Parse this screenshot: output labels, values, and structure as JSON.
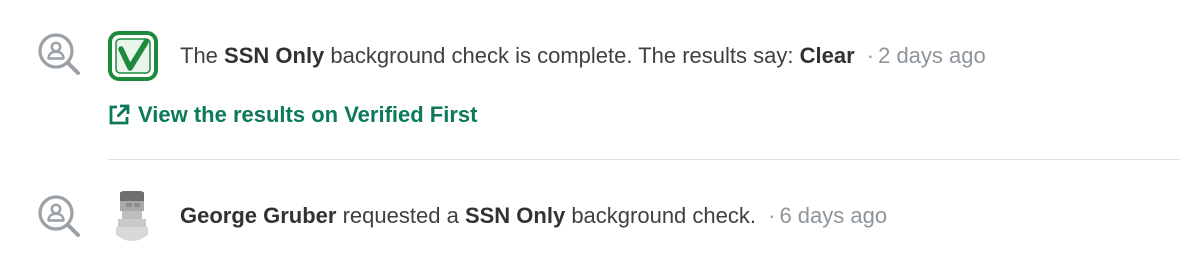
{
  "events": [
    {
      "icon": "person-search-icon",
      "logo": "verified-first-logo",
      "prefix": "The",
      "check_name": "SSN Only",
      "middle": "background check is complete. The results say:",
      "result": "Clear",
      "separator": "·",
      "time": "2 days ago",
      "link": {
        "icon": "external-link-icon",
        "label": "View the results on Verified First"
      }
    },
    {
      "icon": "person-search-icon",
      "avatar": "user-avatar",
      "actor": "George Gruber",
      "verb": "requested a",
      "check_name": "SSN Only",
      "suffix": "background check.",
      "separator": "·",
      "time": "6 days ago"
    }
  ],
  "colors": {
    "accent": "#0c7a5a",
    "logo_green": "#1f8a3c",
    "icon_gray": "#9aa0a6",
    "text": "#3d4145",
    "muted": "#8e959b",
    "divider": "#dcdfe2"
  }
}
